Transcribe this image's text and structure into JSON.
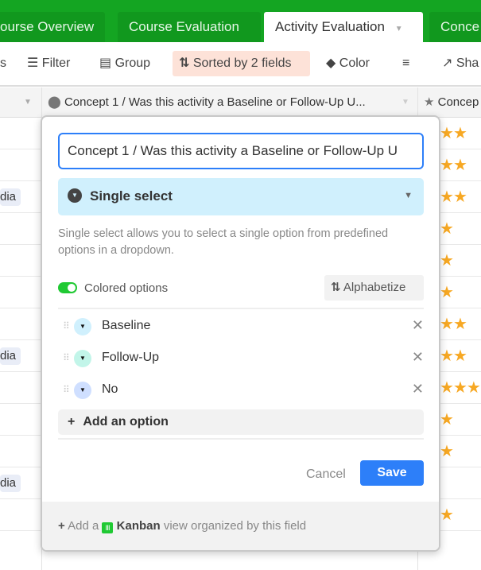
{
  "tabs": [
    {
      "label": "ourse Overview"
    },
    {
      "label": "Course Evaluation"
    },
    {
      "label": "Activity Evaluation",
      "active": true
    },
    {
      "label": "Conce"
    }
  ],
  "toolbar": {
    "partial_left": "s",
    "filter": "Filter",
    "group": "Group",
    "sorted": "Sorted by 2 fields",
    "color": "Color",
    "share": "Sha"
  },
  "header": {
    "field_title": "Concept 1 / Was this activity a Baseline or Follow-Up U...",
    "next_field": "Concep"
  },
  "rows": [
    {
      "badge": "",
      "stars": 2
    },
    {
      "badge": "",
      "stars": 2
    },
    {
      "badge": "dia",
      "stars": 2
    },
    {
      "badge": "",
      "stars": 1
    },
    {
      "badge": "",
      "stars": 1
    },
    {
      "badge": "",
      "stars": 1
    },
    {
      "badge": "",
      "stars": 2
    },
    {
      "badge": "dia",
      "stars": 2
    },
    {
      "badge": "",
      "stars": 3
    },
    {
      "badge": "",
      "stars": 1
    },
    {
      "badge": "",
      "stars": 1
    },
    {
      "badge": "dia",
      "stars": 0
    },
    {
      "badge": "",
      "stars": 1
    }
  ],
  "popup": {
    "field_name": "Concept 1 / Was this activity a Baseline or Follow-Up U",
    "field_type": "Single select",
    "description": "Single select allows you to select a single option from predefined options in a dropdown.",
    "colored_options_label": "Colored options",
    "colored_options_on": true,
    "alphabetize": "Alphabetize",
    "options": [
      {
        "label": "Baseline",
        "color": "#d0f0fd"
      },
      {
        "label": "Follow-Up",
        "color": "#c2f5e9"
      },
      {
        "label": "No",
        "color": "#cfdfff"
      }
    ],
    "add_option": "Add an option",
    "cancel": "Cancel",
    "save": "Save",
    "footer": {
      "prefix": "Add a",
      "view": "Kanban",
      "suffix": "view organized by this field"
    }
  },
  "colors": {
    "tabbar": "#14a522",
    "accent": "#2d7ff9",
    "star": "#f7a823",
    "sorted_bg": "#fde2d8"
  }
}
